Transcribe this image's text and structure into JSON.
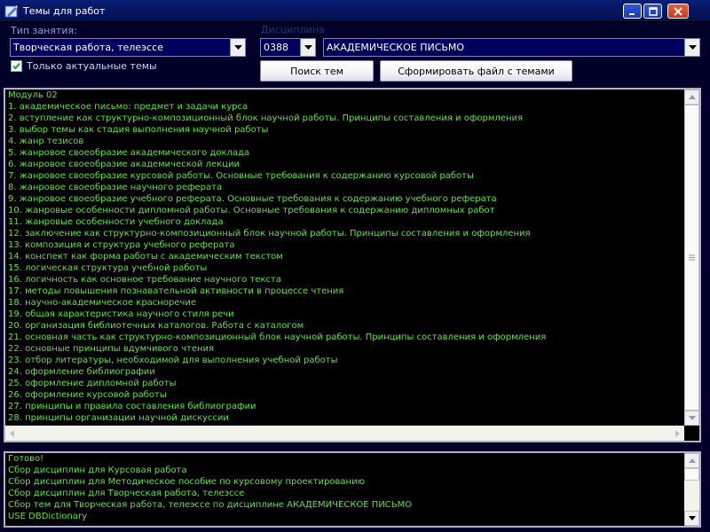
{
  "window": {
    "title": "Темы для работ"
  },
  "form": {
    "lesson_type_label": "Тип занятия:",
    "lesson_type_value": "Творческая работа, телеэссе",
    "discipline_label": "Дисциплина",
    "discipline_code": "0388",
    "discipline_name": "АКАДЕМИЧЕСКОЕ ПИСЬМО",
    "only_actual_label": "Только актуальные темы",
    "only_actual_checked": true,
    "search_button": "Поиск тем",
    "generate_button": "Сформировать файл с темами"
  },
  "topics": [
    "Модуль 02",
    "1. академическое письмо: предмет и задачи курса",
    "2. вступление как структурно-композиционный блок научной работы. Принципы составления и оформления",
    "3. выбор темы как стадия выполнения научной работы",
    "4. жанр тезисов",
    "5. жанровое своеобразие академического доклада",
    "6. жанровое своеобразие академической лекции",
    "7. жанровое своеобразие курсовой работы. Основные требования к содержанию курсовой работы",
    "8. жанровое своеобразие научного реферата",
    "9. жанровое своеобразие учебного реферата. Основные требования к содержанию учебного реферата",
    "10. жанровые особенности дипломной работы. Основные требования к содержанию дипломных работ",
    "11. жанровые особенности учебного доклада",
    "12. заключение как структурно-композиционный блок научной работы. Принципы составления и оформления",
    "13. композиция и структура учебного реферата",
    "14. конспект как форма работы с академическим текстом",
    "15. логическая структура учебной работы",
    "16. логичность как основное требование научного текста",
    "17. методы повышения познавательной активности в процессе чтения",
    "18. научно-академическое красноречие",
    "19. общая характеристика научного стиля речи",
    "20. организация библиотечных каталогов. Работа с каталогом",
    "21. основная часть как структурно-композиционный блок научной работы. Принципы составления и оформления",
    "22. основные принципы вдумчивого чтения",
    "23. отбор литературы, необходимой для выполнения учебной работы",
    "24. оформление библиографии",
    "25. оформление дипломной работы",
    "26. оформление курсовой работы",
    "27. принципы и правила составления библиографии",
    "28. принципы организации научной дискуссии"
  ],
  "log": [
    "Готово!",
    "Сбор дисциплин для Курсовая работа",
    "Сбор дисциплин для Методическое пособие по курсовому проектированию",
    "Сбор дисциплин для Творческая работа, телеэссе",
    "Сбор тем для Творческая работа, телеэссе по дисциплине АКАДЕМИЧЕСКОЕ ПИСЬМО",
    "USE DBDictionary"
  ],
  "icons": {
    "app": "app-icon",
    "minimize": "minimize-icon",
    "maximize": "maximize-icon",
    "close": "close-icon",
    "dropdown": "chevron-down-icon",
    "check": "checkmark-icon"
  },
  "colors": {
    "titlebar": "#0a1e78",
    "background": "#000028",
    "combo_bg": "#00005c",
    "text_green": "#66dd44",
    "label": "#8e9fdc"
  }
}
